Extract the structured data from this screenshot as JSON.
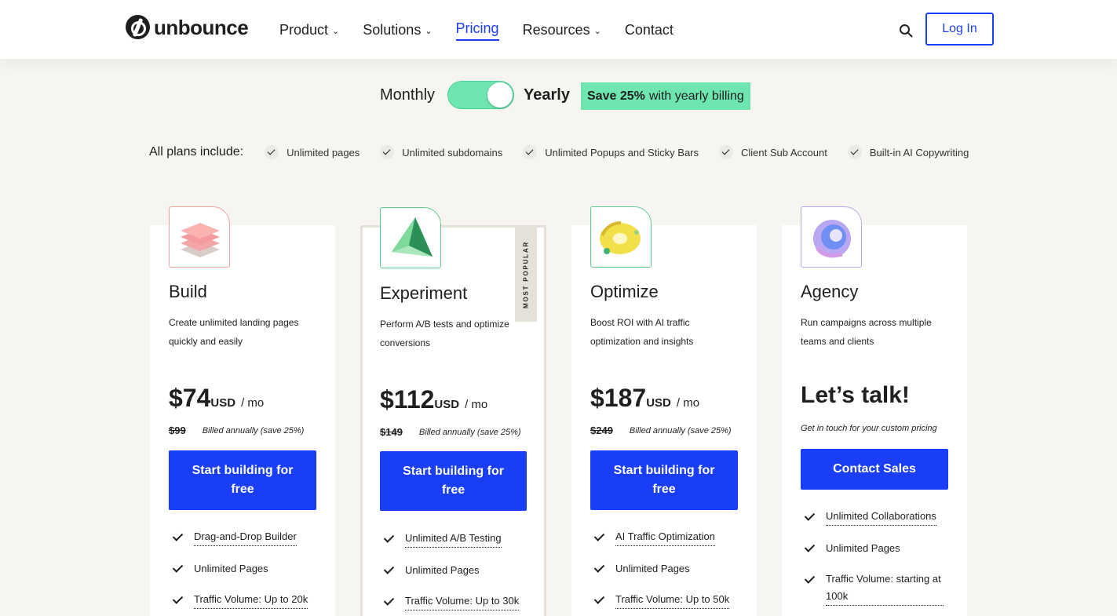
{
  "brand": {
    "name": "unbounce"
  },
  "nav": {
    "items": [
      {
        "label": "Product",
        "dropdown": true
      },
      {
        "label": "Solutions",
        "dropdown": true
      },
      {
        "label": "Pricing",
        "dropdown": false,
        "active": true
      },
      {
        "label": "Resources",
        "dropdown": true
      },
      {
        "label": "Contact",
        "dropdown": false
      }
    ],
    "login_label": "Log In",
    "search_icon": "search-icon"
  },
  "billing": {
    "monthly_label": "Monthly",
    "yearly_label": "Yearly",
    "selected": "Yearly",
    "save_bold": "Save 25%",
    "save_rest": "with yearly billing"
  },
  "includes": {
    "label": "All plans include:",
    "items": [
      "Unlimited pages",
      "Unlimited subdomains",
      "Unlimited Popups and Sticky Bars",
      "Client Sub Account",
      "Built-in AI Copywriting"
    ]
  },
  "plans": [
    {
      "name": "Build",
      "description": "Create unlimited landing pages quickly and easily",
      "price": "$74",
      "currency": "USD",
      "period": "/ mo",
      "original_price": "$99",
      "billing_note": "Billed annually (save 25%)",
      "cta": "Start building for free",
      "features": [
        "Drag-and-Drop Builder",
        "Unlimited Pages",
        "Traffic Volume: Up to 20k"
      ],
      "accent": "#f2a0a0"
    },
    {
      "name": "Experiment",
      "badge": "MOST POPULAR",
      "description": "Perform A/B tests and optimize conversions",
      "price": "$112",
      "currency": "USD",
      "period": "/ mo",
      "original_price": "$149",
      "billing_note": "Billed annually (save 25%)",
      "cta": "Start building for free",
      "features": [
        "Unlimited A/B Testing",
        "Unlimited Pages",
        "Traffic Volume: Up to 30k"
      ],
      "accent": "#5fc98f"
    },
    {
      "name": "Optimize",
      "description": "Boost ROI with AI traffic optimization and insights",
      "price": "$187",
      "currency": "USD",
      "period": "/ mo",
      "original_price": "$249",
      "billing_note": "Billed annually (save 25%)",
      "cta": "Start building for free",
      "features": [
        "AI Traffic Optimization",
        "Unlimited Pages",
        "Traffic Volume: Up to 50k"
      ],
      "accent": "#e8d64a"
    },
    {
      "name": "Agency",
      "description": "Run campaigns across multiple teams and clients",
      "headline": "Let’s talk!",
      "note": "Get in touch for your custom pricing",
      "cta": "Contact Sales",
      "features": [
        "Unlimited Collaborations",
        "Unlimited Pages",
        "Traffic Volume: starting at 100k"
      ],
      "accent": "#b7a8ec"
    }
  ],
  "colors": {
    "brand_blue": "#1a3ef5",
    "mint": "#6ee6b0",
    "page_bg": "#f7f5f2"
  }
}
